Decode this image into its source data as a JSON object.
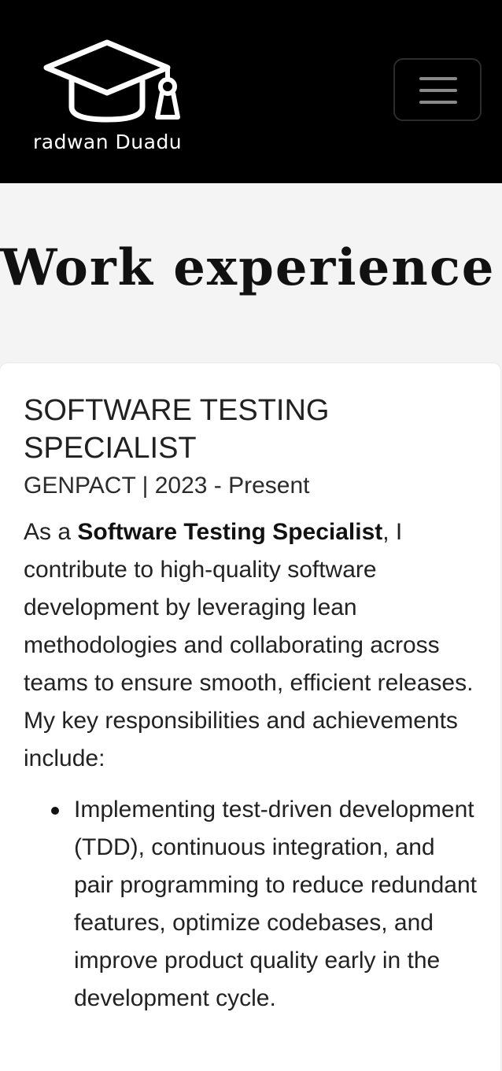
{
  "navbar": {
    "brand_name": "radwan Duadu",
    "logo_icon": "graduation-cap-icon",
    "menu_icon": "hamburger-menu-icon",
    "background": "#000000"
  },
  "hero": {
    "title": "Work experience"
  },
  "experience": {
    "title": "SOFTWARE TESTING SPECIALIST",
    "meta": "GENPACT | 2023 - Present",
    "desc_prefix": "As a ",
    "desc_bold": "Software Testing Specialist",
    "desc_suffix": ", I contribute to high-quality software development by leveraging lean methodologies and collaborating across teams to ensure smooth, efficient releases. My key responsibilities and achievements include:",
    "responsibilities": [
      "Implementing test-driven development (TDD), continuous integration, and pair programming to reduce redundant features, optimize codebases, and improve product quality early in the development cycle."
    ]
  }
}
